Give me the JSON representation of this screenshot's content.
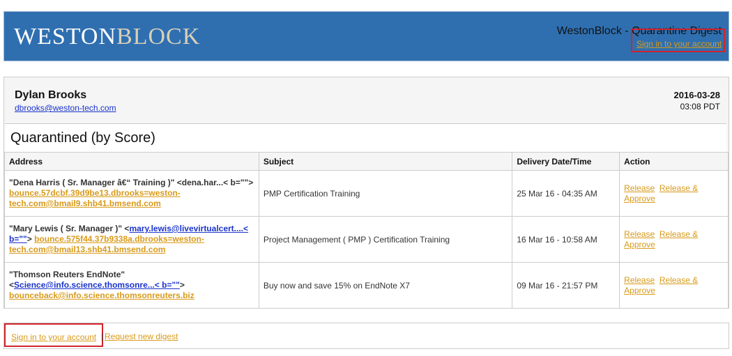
{
  "header": {
    "logo_left": "WESTON",
    "logo_right": "BLOCK",
    "title": "WestonBlock - Quarantine Digest",
    "signin": "Sign in to your account"
  },
  "user": {
    "name": "Dylan Brooks",
    "email": "dbrooks@weston-tech.com",
    "date": "2016-03-28",
    "time": "03:08 PDT"
  },
  "section_title": "Quarantined (by Score)",
  "columns": [
    "Address",
    "Subject",
    "Delivery Date/Time",
    "Action"
  ],
  "rows": [
    {
      "addr_line1": "\"Dena Harris ( Sr. Manager â€“ Training )\" <dena.har...< b=\"\">",
      "addr_link": "bounce.57dcbf.39d9be13.dbrooks=weston-tech.com@bmail9.shb41.bmsend.com",
      "subject": "PMP Certification Training",
      "date": "25 Mar 16 - 04:35 AM",
      "release": "Release",
      "release_approve": "Release & Approve"
    },
    {
      "addr_line1": "\"Mary Lewis ( Sr. Manager )\" <",
      "addr_blue": "mary.lewis@livevirtualcert....< b=\"\"",
      "addr_mid": ">",
      "addr_link": "bounce.575f44.37b9338a.dbrooks=weston-tech.com@bmail13.shb41.bmsend.com",
      "subject": "Project Management ( PMP ) Certification Training",
      "date": "16 Mar 16 - 10:58 AM",
      "release": "Release",
      "release_approve": "Release & Approve"
    },
    {
      "addr_line1": "\"Thomson Reuters EndNote\"",
      "addr_lt": "<",
      "addr_blue": "Science@info.science.thomsonre...< b=\"\"",
      "addr_mid": ">",
      "addr_link": "bounceback@info.science.thomsonreuters.biz",
      "subject": "Buy now and save 15% on EndNote X7",
      "date": "09 Mar 16 - 21:57 PM",
      "release": "Release",
      "release_approve": "Release & Approve"
    }
  ],
  "footer": {
    "signin": "Sign in to your account",
    "separator": "|",
    "request": "Request new digest"
  },
  "colors": {
    "header_bg": "#2f6fb0",
    "link_orange": "#d89a1a",
    "link_blue": "#1a33cc",
    "highlight_red": "#d2232a"
  }
}
